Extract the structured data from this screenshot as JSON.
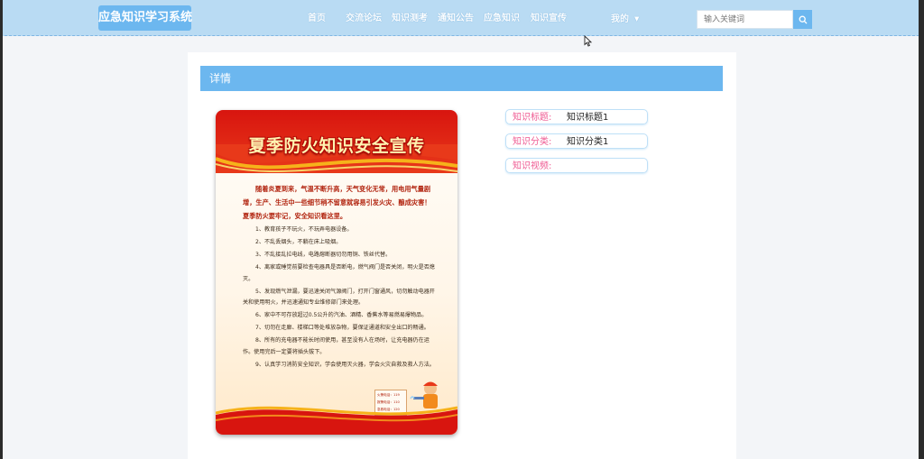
{
  "brand": {
    "logo_text": "应急知识学习系统"
  },
  "nav": {
    "items": [
      {
        "label": "首页"
      },
      {
        "label": "交流论坛"
      },
      {
        "label": "知识测考"
      },
      {
        "label": "通知公告"
      },
      {
        "label": "应急知识"
      },
      {
        "label": "知识宣传"
      }
    ],
    "mine": {
      "label": "我的"
    }
  },
  "search": {
    "placeholder": "输入关键词",
    "value": ""
  },
  "detail": {
    "section_title": "详情",
    "fields": [
      {
        "label": "知识标题:",
        "value": "知识标题1"
      },
      {
        "label": "知识分类:",
        "value": "知识分类1"
      },
      {
        "label": "知识视频:",
        "value": ""
      }
    ]
  },
  "poster": {
    "title": "夏季防火知识安全宣传",
    "intro": "随着炎夏到来，气温不断升高，天气变化无常，用电用气量剧增，生产、生活中一些细节稍不留意就容易引发火灾、酿成灾害！夏季防火要牢记，安全知识看这里。",
    "items": [
      "1、教育孩子不玩火，不玩弄电器设备。",
      "2、不乱丢烟头，不躺在床上吸烟。",
      "3、不乱接乱拉电线，电路熔断器切勿用铜、铁丝代替。",
      "4、离家或睡觉前要检查电器具是否断电，燃气阀门是否关闭，明火是否熄灭。",
      "5、发现燃气泄漏，要迅速关闭气源阀门，打开门窗通风，切勿触动电器开关和使用明火，并迅速通知专业维修部门来处理。",
      "6、家中不可存放超过0.5公升的汽油、酒精、香蕉水等易燃易爆物品。",
      "7、切勿在走廊、楼梯口等处堆放杂物，要保证通道和安全出口的畅通。",
      "8、所有的充电器不能长时间使用，甚至没有人在场时，让充电器仍在运作。使用完后一定要将插头拔下。",
      "9、认真学习消防安全知识，学会使用灭火器，学会火灾自救及救人方法。"
    ],
    "phones": [
      "火警电话：119",
      "报警电话：110",
      "急救电话：120"
    ]
  },
  "colors": {
    "accent": "#6cb7ef",
    "topbar": "#b9dbf3",
    "label_pink": "#ef5b93",
    "poster_red": "#d8150f"
  }
}
